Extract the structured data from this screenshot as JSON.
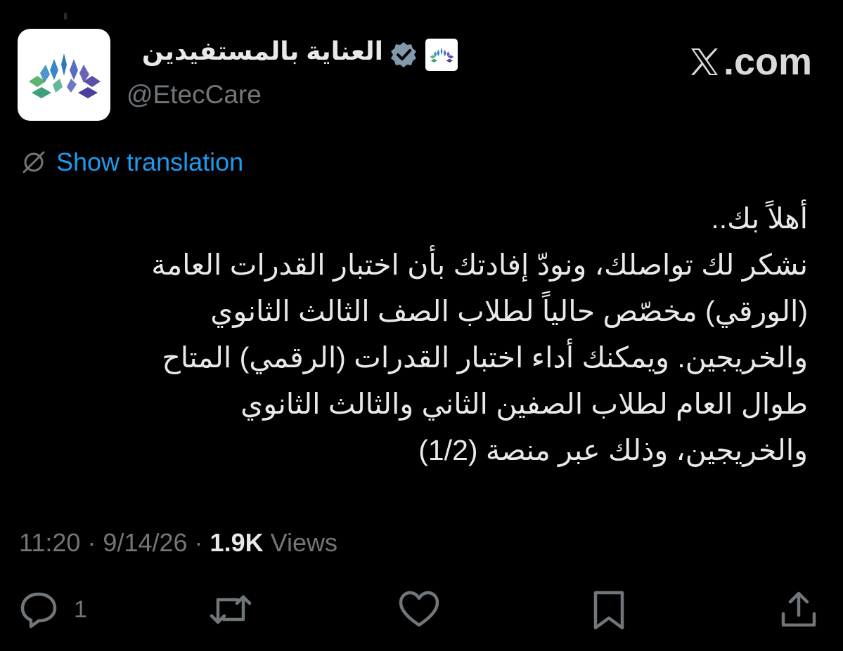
{
  "account": {
    "display_name": "العناية بالمستفيدين",
    "handle": "@EtecCare",
    "verified": true,
    "avatar_icon": "etec-logo-icon"
  },
  "brand": {
    "label": ".com",
    "icon": "x-logo-icon"
  },
  "translation": {
    "label": "Show translation",
    "icon": "translate-globe-icon"
  },
  "tweet": {
    "lines": [
      "أهلاً بك..",
      "نشكر لك تواصلك، ونودّ إفادتك بأن اختبار القدرات العامة",
      "(الورقي) مخصّص حالياً لطلاب الصف الثالث الثانوي",
      "والخريجين. ويمكنك أداء اختبار القدرات (الرقمي) المتاح",
      "طوال العام لطلاب الصفين الثاني والثالث الثانوي",
      "والخريجين، وذلك عبر منصة (1/2)"
    ]
  },
  "meta": {
    "time": "11:20",
    "separator": " · ",
    "date": "9/14/26",
    "views_count": "1.9K",
    "views_label": " Views"
  },
  "actions": {
    "reply_count": "1"
  },
  "colors": {
    "background": "#000000",
    "text": "#e7e9ea",
    "muted": "#71767b",
    "link": "#1d9bf0",
    "badge": "#829aab"
  }
}
